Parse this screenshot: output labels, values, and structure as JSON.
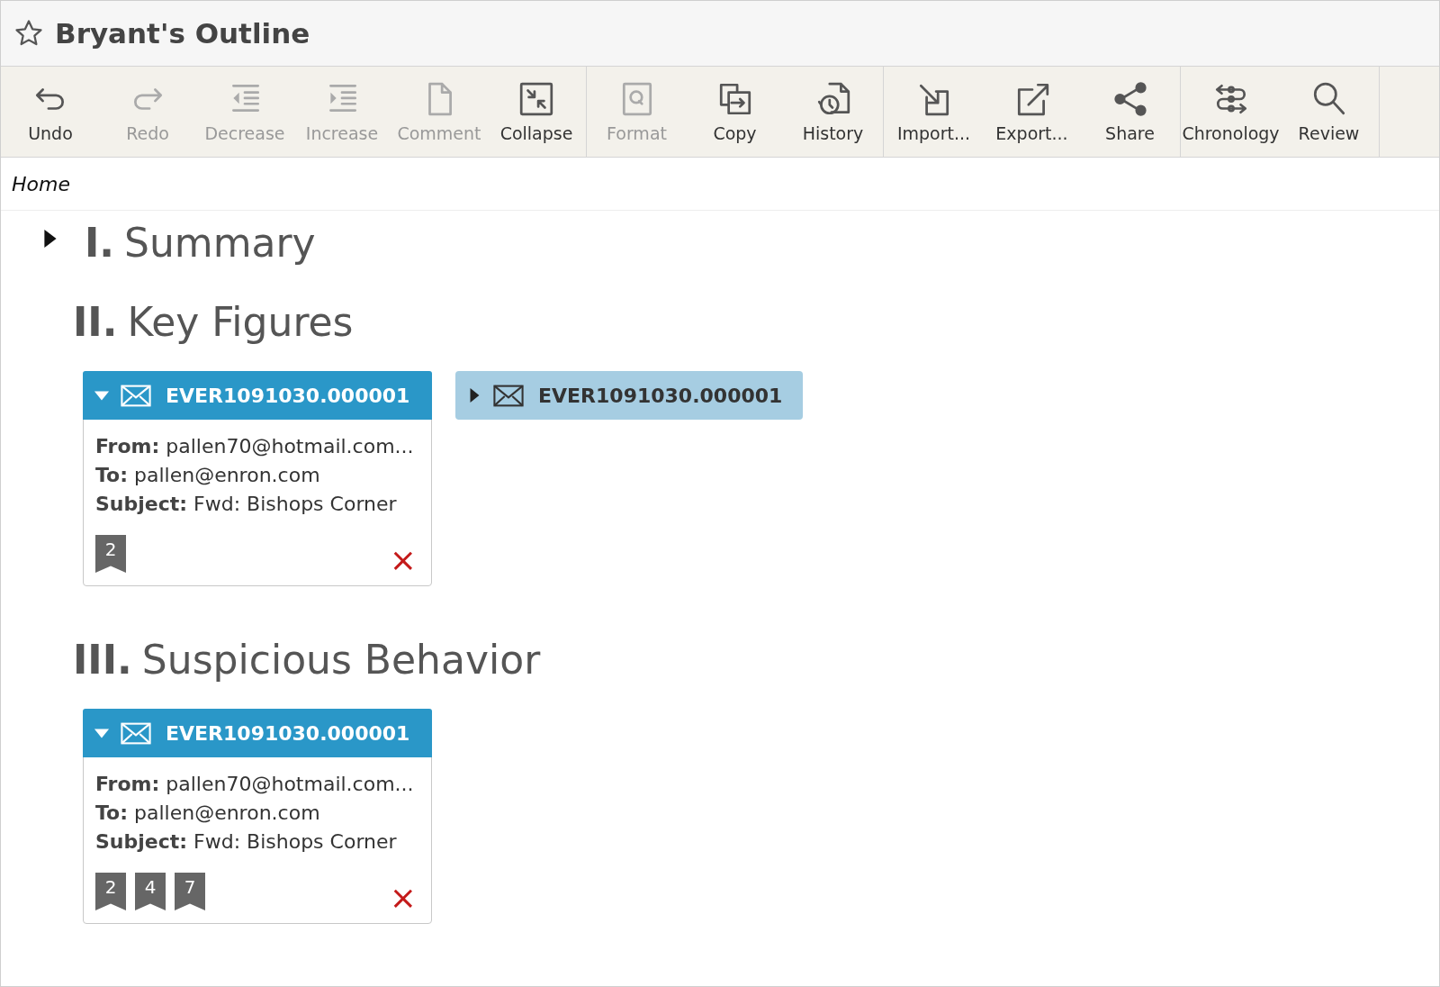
{
  "window": {
    "title": "Bryant's Outline",
    "starred": false
  },
  "toolbar": {
    "groups": [
      {
        "tools": [
          {
            "kind": "undo",
            "label": "Undo",
            "disabled": false
          },
          {
            "kind": "redo",
            "label": "Redo",
            "disabled": true
          },
          {
            "kind": "decrease",
            "label": "Decrease",
            "disabled": true
          },
          {
            "kind": "increase",
            "label": "Increase",
            "disabled": true
          },
          {
            "kind": "comment",
            "label": "Comment",
            "disabled": true
          },
          {
            "kind": "collapse",
            "label": "Collapse",
            "disabled": false
          }
        ]
      },
      {
        "tools": [
          {
            "kind": "format",
            "label": "Format",
            "disabled": true
          },
          {
            "kind": "copy",
            "label": "Copy",
            "disabled": false
          },
          {
            "kind": "history",
            "label": "History",
            "disabled": false
          }
        ]
      },
      {
        "tools": [
          {
            "kind": "import",
            "label": "Import...",
            "disabled": false
          },
          {
            "kind": "export",
            "label": "Export...",
            "disabled": false
          },
          {
            "kind": "share",
            "label": "Share",
            "disabled": false
          }
        ]
      },
      {
        "tools": [
          {
            "kind": "chronology",
            "label": "Chronology",
            "disabled": false
          },
          {
            "kind": "review",
            "label": "Review",
            "disabled": false
          }
        ]
      }
    ]
  },
  "breadcrumb": "Home",
  "sections": [
    {
      "numeral": "I.",
      "title": "Summary",
      "collapsed": true
    },
    {
      "numeral": "II.",
      "title": "Key Figures",
      "collapsed": false,
      "documents": [
        {
          "id": "EVER1091030.000001",
          "expanded": true,
          "from_label": "From:",
          "from": "pallen70@hotmail.com...",
          "to_label": "To:",
          "to": "pallen@enron.com",
          "subject_label": "Subject:",
          "subject": "Fwd: Bishops Corner",
          "tags": [
            "2"
          ],
          "delete": "×"
        },
        {
          "id": "EVER1091030.000001",
          "expanded": false
        }
      ]
    },
    {
      "numeral": "III.",
      "title": "Suspicious Behavior",
      "collapsed": false,
      "documents": [
        {
          "id": "EVER1091030.000001",
          "expanded": true,
          "from_label": "From:",
          "from": "pallen70@hotmail.com...",
          "to_label": "To:",
          "to": "pallen@enron.com",
          "subject_label": "Subject:",
          "subject": "Fwd: Bishops Corner",
          "tags": [
            "2",
            "4",
            "7"
          ],
          "delete": "×"
        }
      ]
    }
  ]
}
